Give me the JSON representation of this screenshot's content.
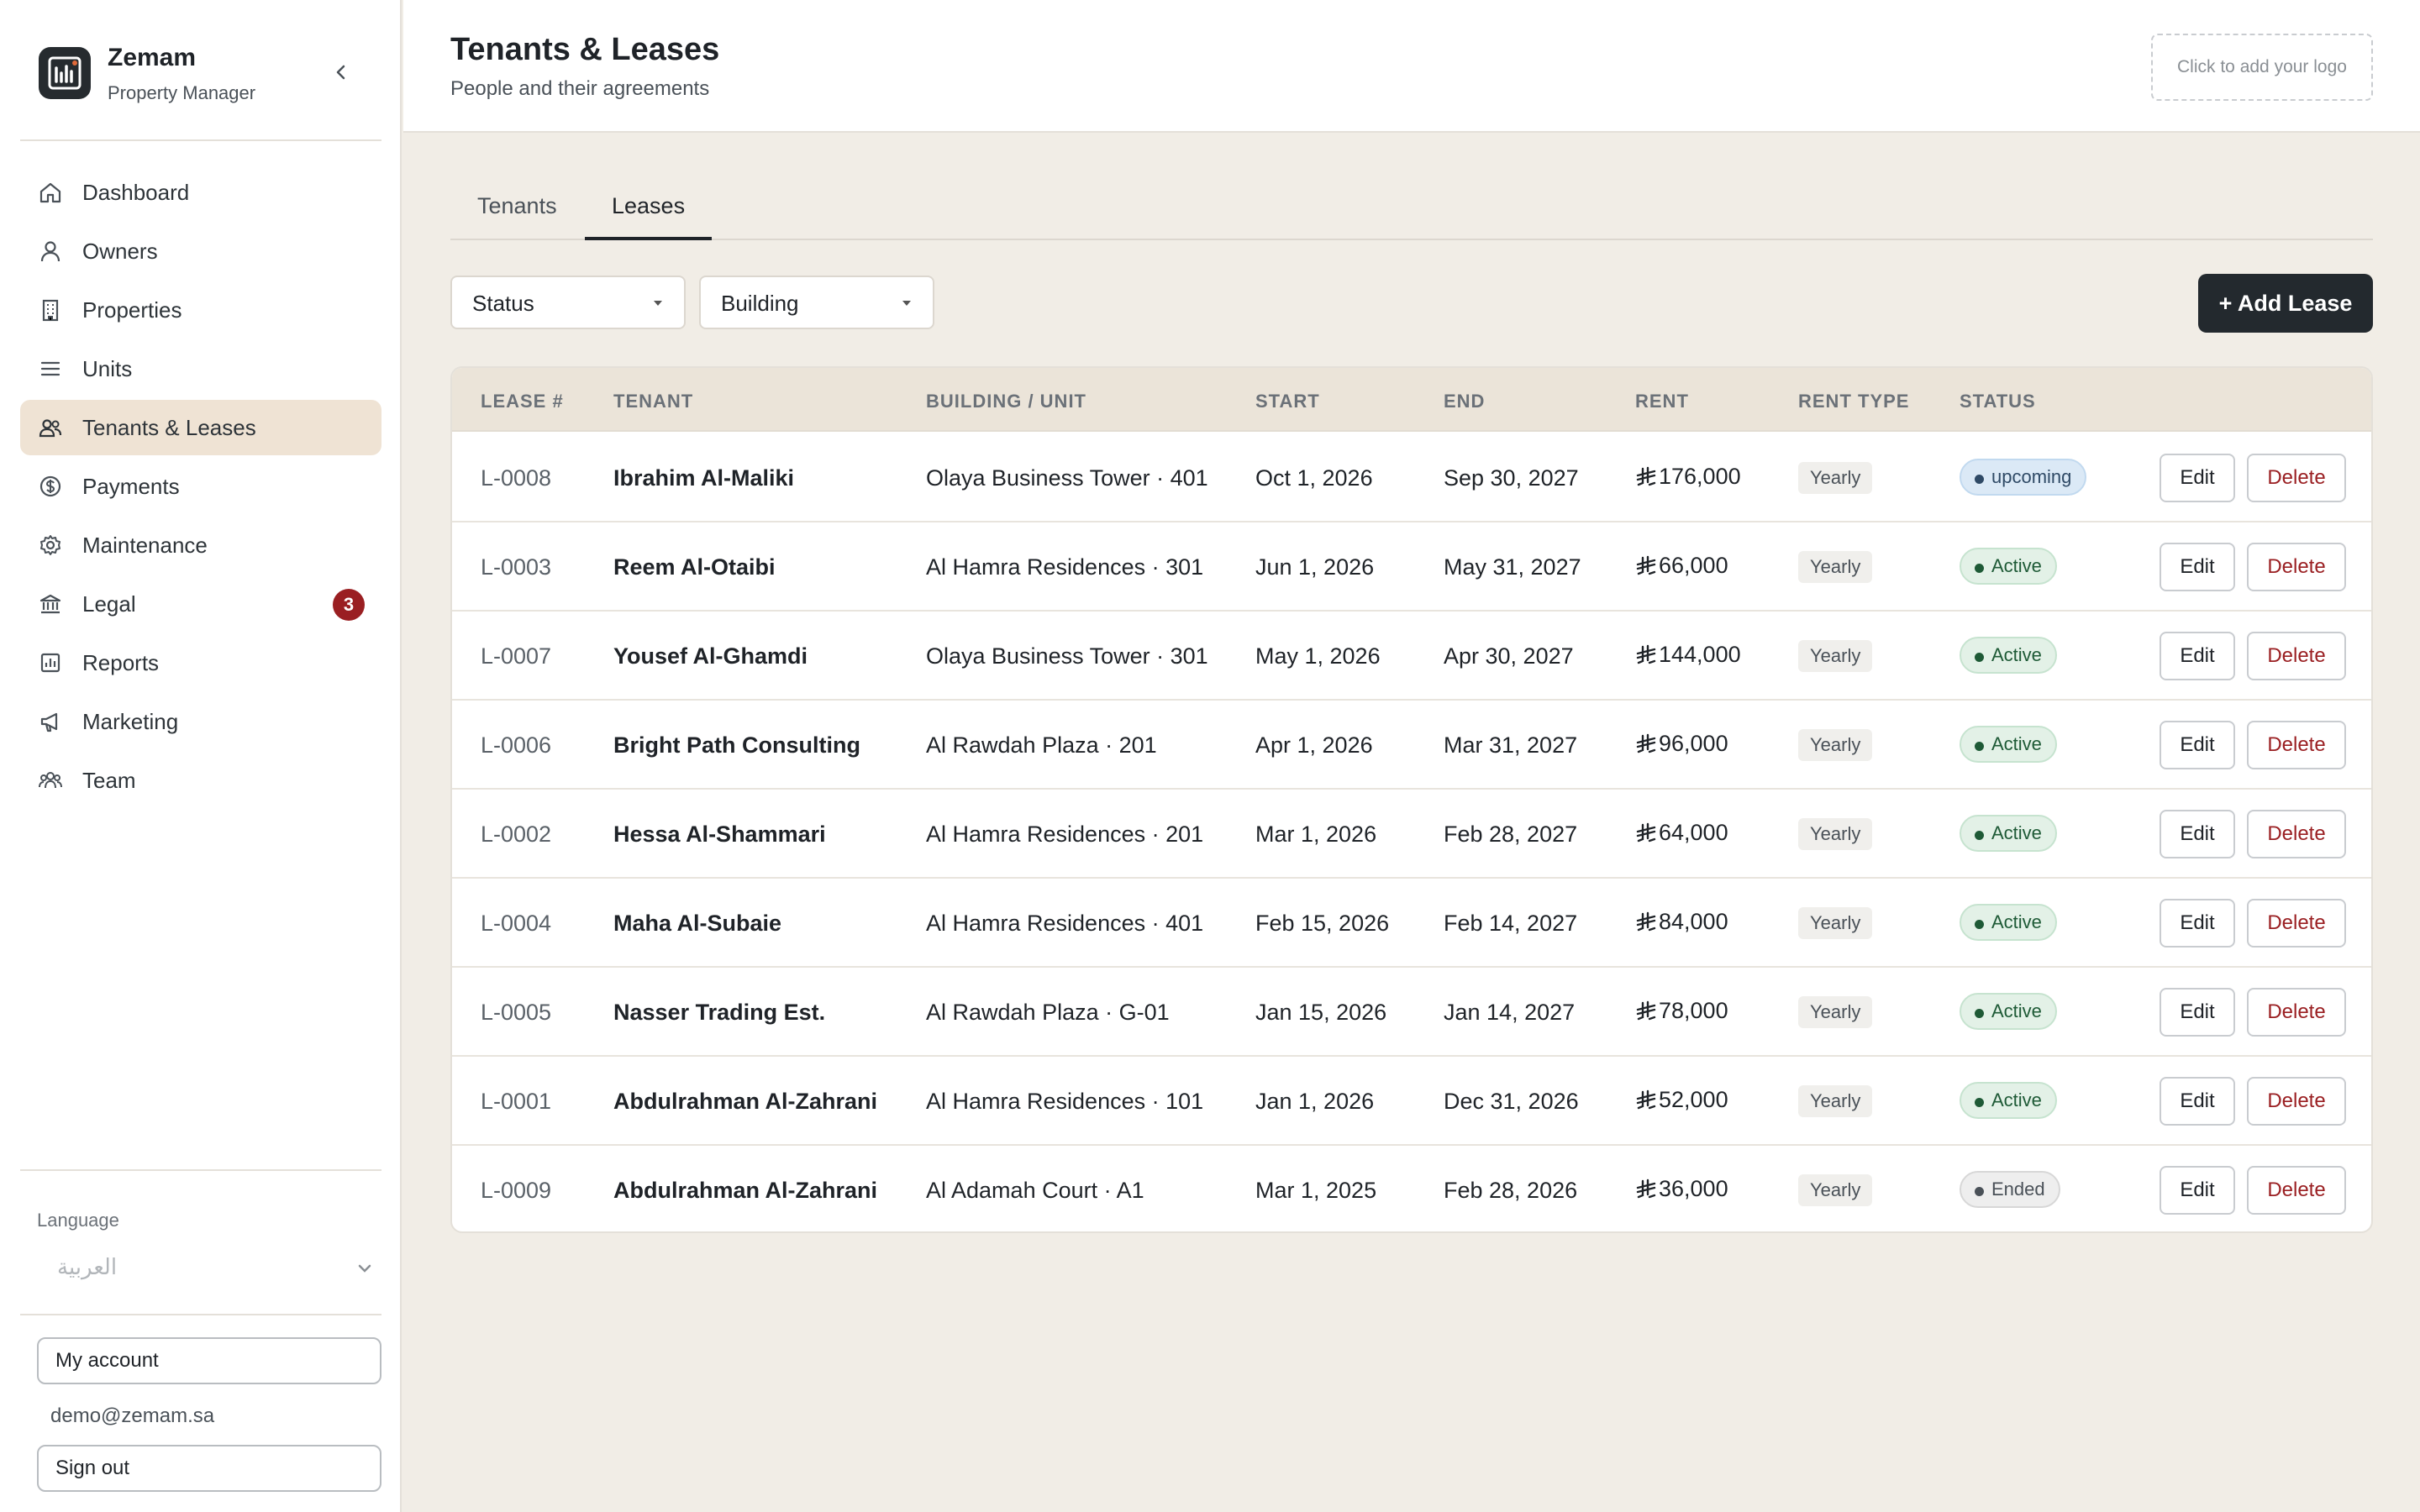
{
  "sidebar": {
    "brand_name": "Zemam",
    "brand_sub": "Property Manager",
    "items": [
      {
        "label": "Dashboard",
        "icon": "home-icon",
        "active": false
      },
      {
        "label": "Owners",
        "icon": "user-icon",
        "active": false
      },
      {
        "label": "Properties",
        "icon": "building-icon",
        "active": false
      },
      {
        "label": "Units",
        "icon": "list-icon",
        "active": false
      },
      {
        "label": "Tenants & Leases",
        "icon": "users-icon",
        "active": true
      },
      {
        "label": "Payments",
        "icon": "dollar-icon",
        "active": false
      },
      {
        "label": "Maintenance",
        "icon": "gear-icon",
        "active": false
      },
      {
        "label": "Legal",
        "icon": "bank-icon",
        "active": false,
        "badge": "3"
      },
      {
        "label": "Reports",
        "icon": "chart-icon",
        "active": false
      },
      {
        "label": "Marketing",
        "icon": "megaphone-icon",
        "active": false
      },
      {
        "label": "Team",
        "icon": "team-icon",
        "active": false
      }
    ],
    "language_label": "Language",
    "language_value": "العربية",
    "my_account": "My account",
    "email": "demo@zemam.sa",
    "sign_out": "Sign out"
  },
  "header": {
    "title": "Tenants & Leases",
    "subtitle": "People and their agreements",
    "logo_placeholder": "Click to add your logo"
  },
  "tabs": [
    {
      "label": "Tenants",
      "active": false
    },
    {
      "label": "Leases",
      "active": true
    }
  ],
  "filters": {
    "status": "Status",
    "building": "Building"
  },
  "add_button": "+ Add Lease",
  "table": {
    "headers": [
      "LEASE #",
      "TENANT",
      "BUILDING / UNIT",
      "START",
      "END",
      "RENT",
      "RENT TYPE",
      "STATUS"
    ],
    "edit_label": "Edit",
    "delete_label": "Delete",
    "rows": [
      {
        "id": "L-0008",
        "tenant": "Ibrahim Al-Maliki",
        "unit": "Olaya Business Tower · 401",
        "start": "Oct 1, 2026",
        "end": "Sep 30, 2027",
        "rent": "176,000",
        "rent_type": "Yearly",
        "status": "upcoming"
      },
      {
        "id": "L-0003",
        "tenant": "Reem Al-Otaibi",
        "unit": "Al Hamra Residences · 301",
        "start": "Jun 1, 2026",
        "end": "May 31, 2027",
        "rent": "66,000",
        "rent_type": "Yearly",
        "status": "Active"
      },
      {
        "id": "L-0007",
        "tenant": "Yousef Al-Ghamdi",
        "unit": "Olaya Business Tower · 301",
        "start": "May 1, 2026",
        "end": "Apr 30, 2027",
        "rent": "144,000",
        "rent_type": "Yearly",
        "status": "Active"
      },
      {
        "id": "L-0006",
        "tenant": "Bright Path Consulting",
        "unit": "Al Rawdah Plaza · 201",
        "start": "Apr 1, 2026",
        "end": "Mar 31, 2027",
        "rent": "96,000",
        "rent_type": "Yearly",
        "status": "Active"
      },
      {
        "id": "L-0002",
        "tenant": "Hessa Al-Shammari",
        "unit": "Al Hamra Residences · 201",
        "start": "Mar 1, 2026",
        "end": "Feb 28, 2027",
        "rent": "64,000",
        "rent_type": "Yearly",
        "status": "Active"
      },
      {
        "id": "L-0004",
        "tenant": "Maha Al-Subaie",
        "unit": "Al Hamra Residences · 401",
        "start": "Feb 15, 2026",
        "end": "Feb 14, 2027",
        "rent": "84,000",
        "rent_type": "Yearly",
        "status": "Active"
      },
      {
        "id": "L-0005",
        "tenant": "Nasser Trading Est.",
        "unit": "Al Rawdah Plaza · G-01",
        "start": "Jan 15, 2026",
        "end": "Jan 14, 2027",
        "rent": "78,000",
        "rent_type": "Yearly",
        "status": "Active"
      },
      {
        "id": "L-0001",
        "tenant": "Abdulrahman Al-Zahrani",
        "unit": "Al Hamra Residences · 101",
        "start": "Jan 1, 2026",
        "end": "Dec 31, 2026",
        "rent": "52,000",
        "rent_type": "Yearly",
        "status": "Active"
      },
      {
        "id": "L-0009",
        "tenant": "Abdulrahman Al-Zahrani",
        "unit": "Al Adamah Court · A1",
        "start": "Mar 1, 2025",
        "end": "Feb 28, 2026",
        "rent": "36,000",
        "rent_type": "Yearly",
        "status": "Ended"
      }
    ]
  }
}
